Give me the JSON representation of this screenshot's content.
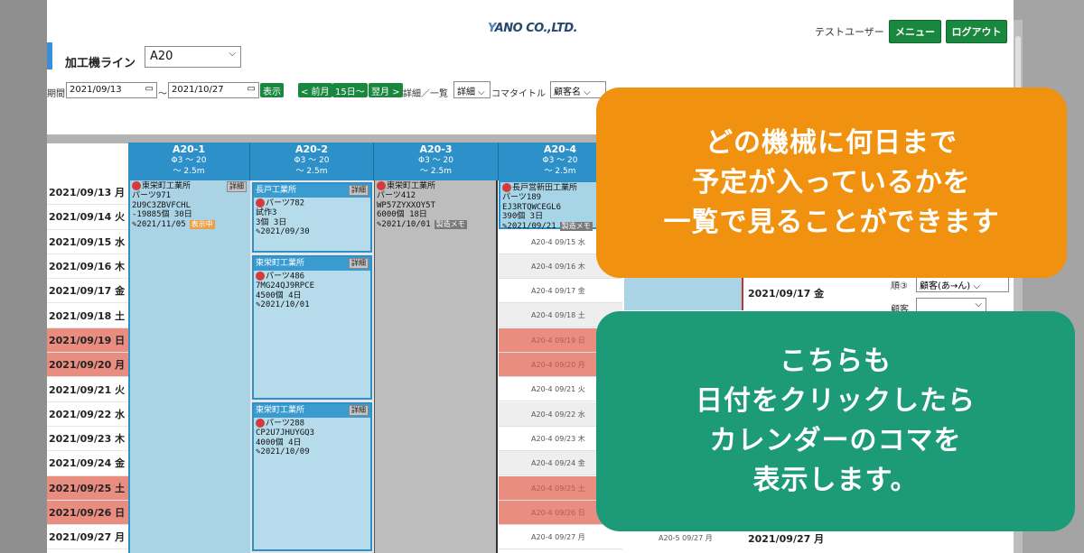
{
  "header": {
    "logo_text": "ANO CO.,LTD.",
    "logo_mark": "Y",
    "user_name": "テストユーザー",
    "menu_label": "メニュー",
    "logout_label": "ログアウト"
  },
  "line": {
    "label": "加工機ライン",
    "selected": "A20"
  },
  "filters": {
    "period_label": "期間",
    "start_date": "2021/09/13",
    "tilde": "～",
    "end_date": "2021/10/27",
    "show_label": "表示",
    "prev_month": "< 前月",
    "days15": "15日～",
    "next_month": "翌月 >",
    "mode_label": "詳細／一覧",
    "mode_value": "詳細",
    "title_label": "コマタイトル",
    "title_value": "顧客名"
  },
  "machines": [
    {
      "name": "A20-1",
      "line1": "Φ3 ～ 20",
      "line2": "～ 2.5m"
    },
    {
      "name": "A20-2",
      "line1": "Φ3 ～ 20",
      "line2": "～ 2.5m"
    },
    {
      "name": "A20-3",
      "line1": "Φ3 ～ 20",
      "line2": "～ 2.5m"
    },
    {
      "name": "A20-4",
      "line1": "Φ3 ～ 20",
      "line2": "～ 2.5m"
    }
  ],
  "dates": [
    {
      "label": "2021/09/13 月",
      "holiday": false
    },
    {
      "label": "2021/09/14 火",
      "holiday": false
    },
    {
      "label": "2021/09/15 水",
      "holiday": false
    },
    {
      "label": "2021/09/16 木",
      "holiday": false
    },
    {
      "label": "2021/09/17 金",
      "holiday": false
    },
    {
      "label": "2021/09/18 土",
      "holiday": false
    },
    {
      "label": "2021/09/19 日",
      "holiday": true
    },
    {
      "label": "2021/09/20 月",
      "holiday": true
    },
    {
      "label": "2021/09/21 火",
      "holiday": false
    },
    {
      "label": "2021/09/22 水",
      "holiday": false
    },
    {
      "label": "2021/09/23 木",
      "holiday": false
    },
    {
      "label": "2021/09/24 金",
      "holiday": false
    },
    {
      "label": "2021/09/25 土",
      "holiday": true
    },
    {
      "label": "2021/09/26 日",
      "holiday": true
    },
    {
      "label": "2021/09/27 月",
      "holiday": false
    }
  ],
  "jobs": {
    "a1": {
      "customer": "東栄町工業所",
      "detail": "詳細",
      "part": "パーツ971",
      "code": "2U9C3ZBVFCHL",
      "qty": "-19885個 30日",
      "due": "2021/11/05",
      "tag": "表示中"
    },
    "a2a": {
      "customer": "長戸工業所",
      "detail": "詳細",
      "part": "パーツ782",
      "code": "試作3",
      "qty": "3個 3日",
      "due": "2021/09/30"
    },
    "a2b": {
      "customer": "東栄町工業所",
      "detail": "詳細",
      "part": "パーツ486",
      "code": "7MG24QJ9RPCE",
      "qty": "4500個 4日",
      "due": "2021/10/01"
    },
    "a2c": {
      "customer": "東栄町工業所",
      "detail": "詳細",
      "part": "パーツ288",
      "code": "CP2U7JHUYGQ3",
      "qty": "4000個 4日",
      "due": "2021/10/09"
    },
    "a3": {
      "customer": "東栄町工業所",
      "part": "パーツ412",
      "code": "WP57ZYXXOY5T",
      "qty": "6000個 18日",
      "due": "2021/10/01",
      "tag": "製造メモ"
    },
    "a4": {
      "customer": "長戸営新田工業所",
      "part": "パーツ189",
      "code": "EJ3RTQWCEGL6",
      "qty": "390個 3日",
      "due": "2021/09/21",
      "tag": "製造メモ"
    }
  },
  "a4_rows": [
    "A20-4 09/15 水",
    "A20-4 09/16 木",
    "A20-4 09/17 金",
    "A20-4 09/18 土",
    "A20-4 09/19 日",
    "A20-4 09/20 月",
    "A20-4 09/21 火",
    "A20-4 09/22 水",
    "A20-4 09/23 木",
    "A20-4 09/24 金",
    "A20-4 09/25 土",
    "A20-4 09/26 日",
    "A20-4 09/27 月"
  ],
  "right_panel": {
    "date1": "2021/09/17 金",
    "order_label": "順③",
    "order_value": "顧客(あ→ん)",
    "customer_label": "顧客",
    "a205_text": "A20-5 09/27 月",
    "date2": "2021/09/27 月"
  },
  "overlays": {
    "orange_lines": [
      "どの機械に何日まで",
      "予定が入っているかを",
      "一覧で見ることができます"
    ],
    "green_lines": [
      "こちらも",
      "日付をクリックしたら",
      "カレンダーのコマを",
      "表示します。"
    ]
  }
}
